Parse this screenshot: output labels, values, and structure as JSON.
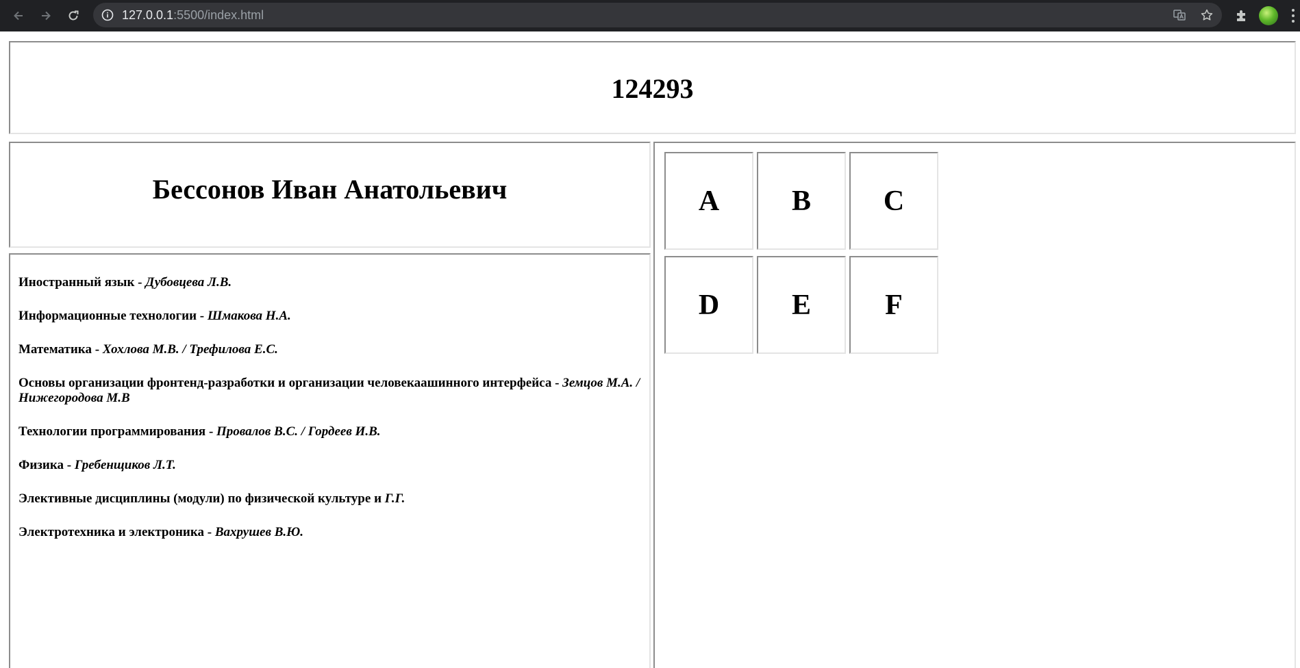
{
  "browser": {
    "url_host": "127.0.0.1",
    "url_rest": ":5500/index.html"
  },
  "page": {
    "header_number": "124293",
    "student_name": "Бессонов Иван Анатольевич",
    "subjects": [
      {
        "name": "Иностранный язык",
        "sep": " - ",
        "teacher": "Дубовцева Л.В."
      },
      {
        "name": "Информационные технологии",
        "sep": " - ",
        "teacher": "Шмакова Н.А."
      },
      {
        "name": "Математика",
        "sep": " - ",
        "teacher": "Хохлова М.В. / Трефилова Е.С."
      },
      {
        "name": "Основы организации фронтенд-разработки и организации человекаашинного интерфейса",
        "sep": " - ",
        "teacher": "Земцов М.А. / Нижегородова М.В"
      },
      {
        "name": "Технологии программирования",
        "sep": " - ",
        "teacher": "Провалов В.С. / Гордеев И.В."
      },
      {
        "name": "Физика",
        "sep": " - ",
        "teacher": "Гребенщиков Л.Т."
      },
      {
        "name": "Элективные дисциплины (модули) по физической культуре",
        "sep": " и ",
        "teacher": "Г.Г."
      },
      {
        "name": "Электротехника и электроника",
        "sep": " - ",
        "teacher": "Вахрушев В.Ю."
      }
    ],
    "grid_letters": [
      "A",
      "B",
      "C",
      "D",
      "E",
      "F"
    ]
  }
}
